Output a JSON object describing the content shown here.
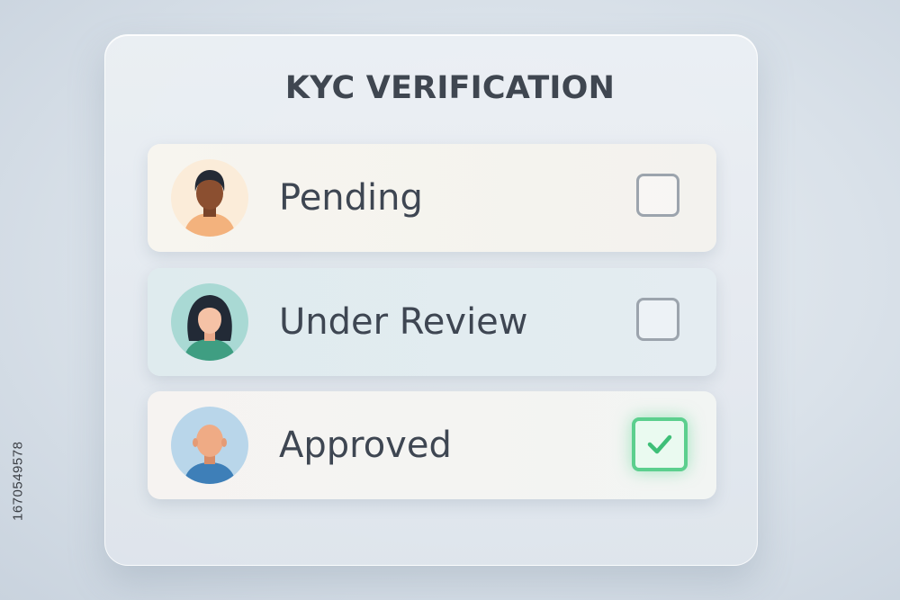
{
  "card": {
    "title": "KYC VERIFICATION"
  },
  "rows": [
    {
      "label": "Pending",
      "checked": false,
      "avatar_icon": "person-avatar-icon"
    },
    {
      "label": "Under Review",
      "checked": false,
      "avatar_icon": "person-avatar-icon"
    },
    {
      "label": "Approved",
      "checked": true,
      "avatar_icon": "person-avatar-icon"
    }
  ],
  "watermark": "1670549578",
  "colors": {
    "accent_green": "#5ccf8e",
    "text": "#3e4652",
    "checkbox_border": "#9ca4ad"
  }
}
